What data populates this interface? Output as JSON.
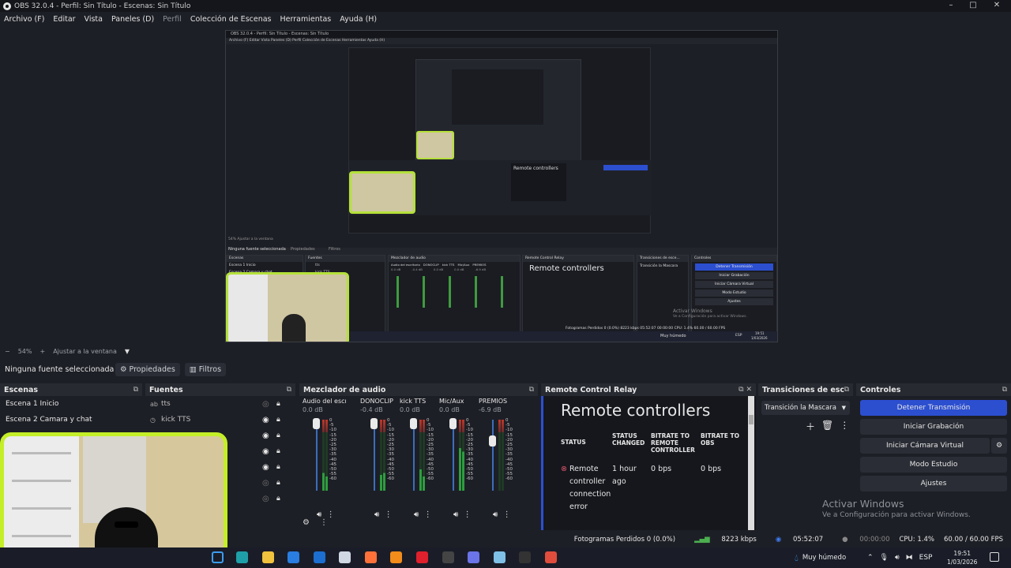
{
  "window": {
    "title": "OBS 32.0.4 - Perfil: Sin Título - Escenas: Sin Título",
    "min": "–",
    "max": "□",
    "close": "✕"
  },
  "menu": [
    "Archivo (F)",
    "Editar",
    "Vista",
    "Paneles (D)",
    "Perfil",
    "Colección de Escenas",
    "Herramientas",
    "Ayuda (H)"
  ],
  "nested": {
    "title": "OBS 32.0.4 - Perfil: Sin Título - Escenas: Sin Título",
    "menu": "Archivo (F)   Editar   Vista   Paneles (D)   Perfil   Colección de Escenas   Herramientas   Ayuda (H)",
    "zoom": "54%   Ajustar a la ventana",
    "nosel": "Ninguna fuente seleccionada",
    "props": "Propiedades",
    "filters": "Filtros",
    "scenes_title": "Escenas",
    "sources_title": "Fuentes",
    "mixer_title": "Mezclador de audio",
    "relay_title": "Remote Control Relay",
    "trans_title": "Transiciones de esce...",
    "controls_title": "Controles",
    "scene1": "Escena 1 Inicio",
    "scene2": "Escena 2 Camara y chat",
    "src1": "tts",
    "src2": "kick TTS",
    "rc": "Remote controllers",
    "trans": "Transición la Mascara",
    "stop": "Detener Transmisión",
    "rec": "Iniciar Grabación",
    "vcam": "Iniciar Cámara Virtual",
    "studio": "Modo Estudio",
    "settings": "Ajustes",
    "activate": "Activar Windows",
    "activate2": "Ve a Configuración para activar Windows.",
    "status": "Fotogramas Perdidos 0 (0.0%)   8223 kbps   05:52:07   00:00:00   CPU: 1.4%   60.00 / 60.00 FPS",
    "weather": "Muy húmedo",
    "time": "19:51",
    "date": "1/03/2026",
    "lang": "ESP",
    "mixer_cols": [
      "Audio del escritorio",
      "DONOCLIP",
      "kick TTS",
      "Mic/Aux",
      "PREMIOS"
    ],
    "mixer_dbs": [
      "0.0 dB",
      "-0.4 dB",
      "0.0 dB",
      "0.0 dB",
      "-6.9 dB"
    ]
  },
  "zoombar": {
    "level": "54%",
    "fit": "Ajustar a la ventana"
  },
  "sourcebar": {
    "no_selection": "Ninguna fuente seleccionada",
    "properties": "Propiedades",
    "filters": "Filtros"
  },
  "scenes": {
    "title": "Escenas",
    "items": [
      "Escena 1 Inicio",
      "Escena 2 Camara y chat"
    ]
  },
  "sources": {
    "title": "Fuentes",
    "items": [
      {
        "type": "ab",
        "name": "tts"
      },
      {
        "type": "◷",
        "name": "kick TTS"
      }
    ]
  },
  "mixer": {
    "title": "Mezclador de audio",
    "channels": [
      {
        "name": "Audio del escritorio",
        "db": "0.0 dB"
      },
      {
        "name": "DONOCLIP",
        "db": "-0.4 dB"
      },
      {
        "name": "kick  TTS",
        "db": "0.0 dB"
      },
      {
        "name": "Mic/Aux",
        "db": "0.0 dB"
      },
      {
        "name": "PREMIOS",
        "db": "-6.9 dB"
      }
    ],
    "scale": [
      "0",
      "-5",
      "-10",
      "-15",
      "-20",
      "-25",
      "-30",
      "-35",
      "-40",
      "-45",
      "-50",
      "-55",
      "-60"
    ]
  },
  "relay": {
    "title": "Remote Control Relay",
    "heading": "Remote controllers",
    "columns": [
      "STATUS",
      "STATUS CHANGED",
      "BITRATE TO REMOTE CONTROLLER",
      "BITRATE TO OBS"
    ],
    "row": {
      "status": "Remote controller connection error",
      "changed": "1 hour ago",
      "bitrate_remote": "0 bps",
      "bitrate_obs": "0 bps"
    }
  },
  "transitions": {
    "title": "Transiciones de esce...",
    "selected": "Transición la Mascara"
  },
  "controls": {
    "title": "Controles",
    "stop_stream": "Detener Transmisión",
    "start_record": "Iniciar Grabación",
    "start_vcam": "Iniciar Cámara Virtual",
    "studio_mode": "Modo Estudio",
    "settings": "Ajustes"
  },
  "watermark": {
    "line1": "Activar Windows",
    "line2": "Ve a Configuración para activar Windows."
  },
  "status": {
    "dropped": "Fotogramas Perdidos 0 (0.0%)",
    "bitrate": "8223 kbps",
    "stream_time": "05:52:07",
    "rec_time": "00:00:00",
    "cpu": "CPU: 1.4%",
    "fps": "60.00 / 60.00 FPS"
  },
  "taskbar": {
    "weather": "Muy húmedo",
    "lang": "ESP",
    "time": "19:51",
    "date": "1/03/2026"
  },
  "colors": {
    "accent": "#2c4fd0",
    "cam_border": "#c4ef28",
    "bg": "#1d1f26",
    "error": "#e0566b"
  }
}
